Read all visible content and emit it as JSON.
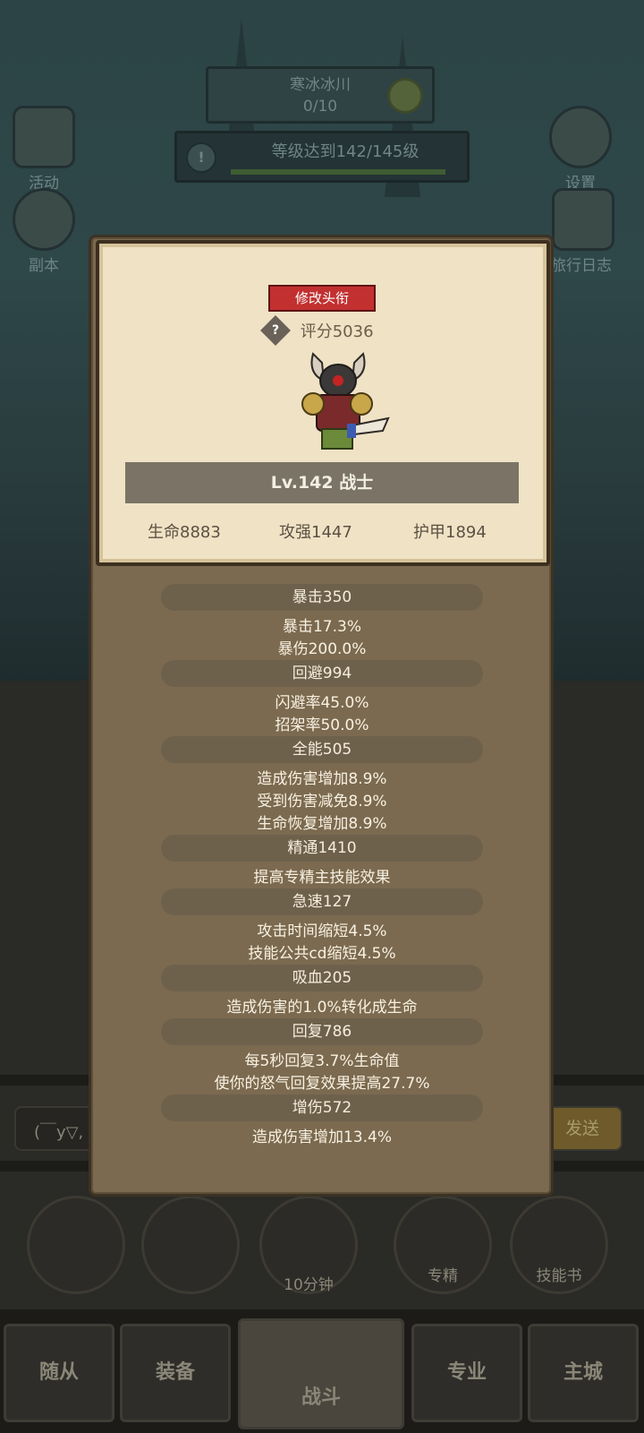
{
  "top": {
    "area_name": "寒冰冰川",
    "area_progress": "0/10",
    "quest_text": "等级达到142/145级",
    "quest_icon": "!"
  },
  "left_icons": [
    {
      "label": "活动",
      "icon": "scroll-icon"
    },
    {
      "label": "副本",
      "icon": "portal-icon"
    }
  ],
  "right_icons": [
    {
      "label": "设置",
      "icon": "gear-icon"
    },
    {
      "label": "旅行日志",
      "icon": "book-icon"
    }
  ],
  "profile": {
    "rename_button": "修改头衔",
    "help_icon": "?",
    "score": "评分5036",
    "level_class": "Lv.142 战士",
    "hp": "生命8883",
    "attack": "攻强1447",
    "armor": "护甲1894"
  },
  "stats": [
    {
      "name": "暴击350",
      "lines": [
        "暴击17.3%",
        "暴伤200.0%"
      ]
    },
    {
      "name": "回避994",
      "lines": [
        "闪避率45.0%",
        "招架率50.0%"
      ]
    },
    {
      "name": "全能505",
      "lines": [
        "造成伤害增加8.9%",
        "受到伤害减免8.9%",
        "生命恢复增加8.9%"
      ]
    },
    {
      "name": "精通1410",
      "lines": [
        "提高专精主技能效果"
      ]
    },
    {
      "name": "急速127",
      "lines": [
        "攻击时间缩短4.5%",
        "技能公共cd缩短4.5%"
      ]
    },
    {
      "name": "吸血205",
      "lines": [
        "造成伤害的1.0%转化成生命"
      ]
    },
    {
      "name": "回复786",
      "lines": [
        "每5秒回复3.7%生命值",
        "使你的怒气回复效果提高27.7%"
      ]
    },
    {
      "name": "增伤572",
      "lines": [
        "造成伤害增加13.4%"
      ]
    }
  ],
  "chat": {
    "text": "(￣y▽,",
    "send": "发送"
  },
  "action_buttons": [
    {
      "label": "",
      "icon": "potion-icon"
    },
    {
      "label": "",
      "icon": "bread-icon"
    },
    {
      "label": "10分钟",
      "icon": "chest-icon"
    },
    {
      "label": "专精",
      "icon": "target-icon"
    },
    {
      "label": "技能书",
      "icon": "skill-book-icon"
    }
  ],
  "nav": {
    "followers": "随从",
    "equipment": "装备",
    "battle": "战斗",
    "profession": "专业",
    "city": "主城"
  },
  "colors": {
    "rename_button": "#c23030",
    "panel": "#7b6a50",
    "card": "#efe2c5"
  }
}
